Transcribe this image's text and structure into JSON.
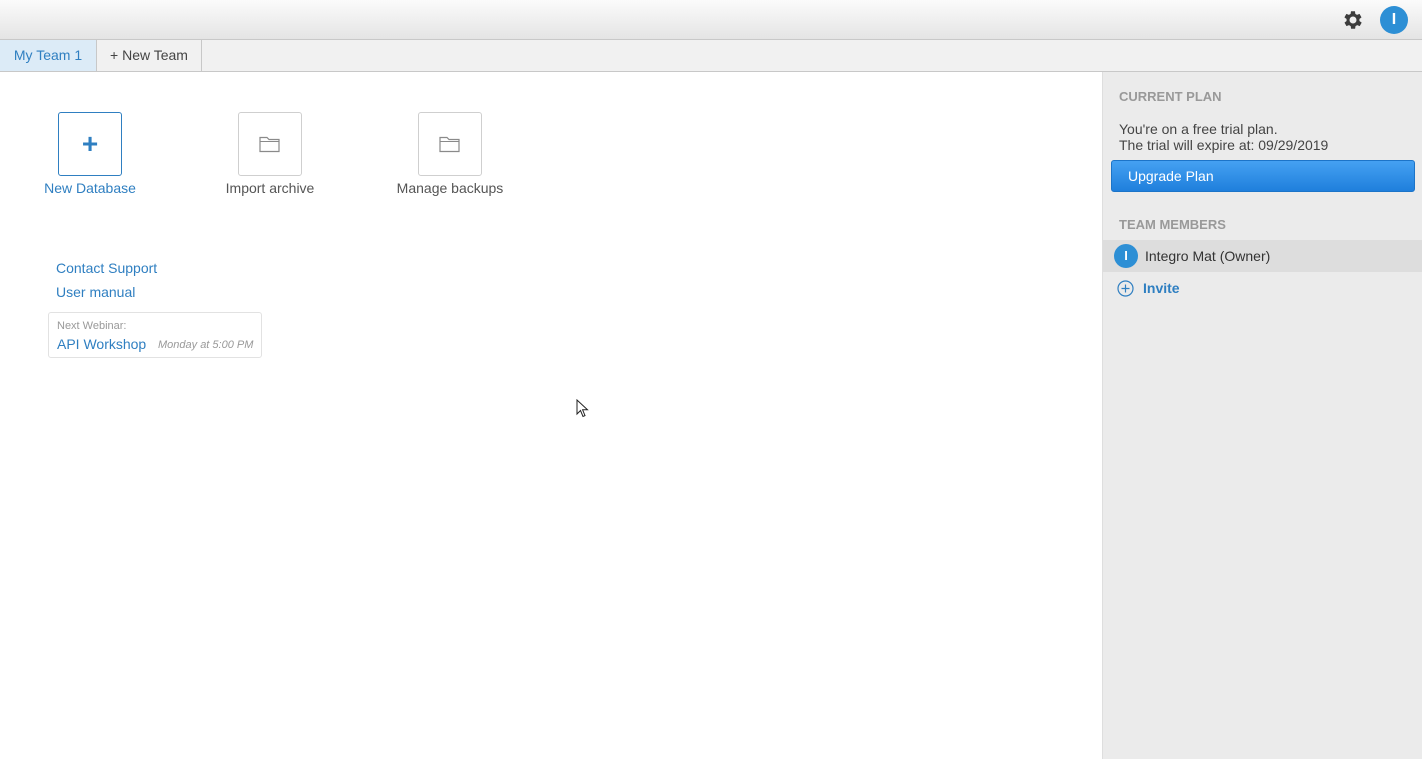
{
  "header": {
    "settings_icon": "gear-icon",
    "user_initial": "I",
    "avatar_color": "#2d8fd5"
  },
  "tabs": [
    {
      "label": "My Team 1",
      "active": true
    },
    {
      "label": "+ New Team",
      "active": false
    }
  ],
  "actions": {
    "new_database": {
      "icon": "+",
      "label": "New Database"
    },
    "import_archive": {
      "icon": "folder-icon",
      "label": "Import archive"
    },
    "manage_backups": {
      "icon": "folder-icon",
      "label": "Manage backups"
    }
  },
  "links": {
    "contact_support": "Contact Support",
    "user_manual": "User manual"
  },
  "webinar": {
    "heading": "Next Webinar:",
    "title": "API Workshop",
    "time": "Monday at 5:00 PM"
  },
  "sidebar": {
    "plan_heading": "CURRENT PLAN",
    "plan_line1": "You're on a free trial plan.",
    "plan_line2": "The trial will expire at: 09/29/2019",
    "upgrade_label": "Upgrade Plan",
    "members_heading": "TEAM MEMBERS",
    "members": [
      {
        "initial": "I",
        "name": "Integro Mat (Owner)"
      }
    ],
    "invite_label": "Invite"
  },
  "colors": {
    "accent": "#2f7fc1",
    "button": "#2f8ae5",
    "sidebar_bg": "#ebebeb"
  }
}
